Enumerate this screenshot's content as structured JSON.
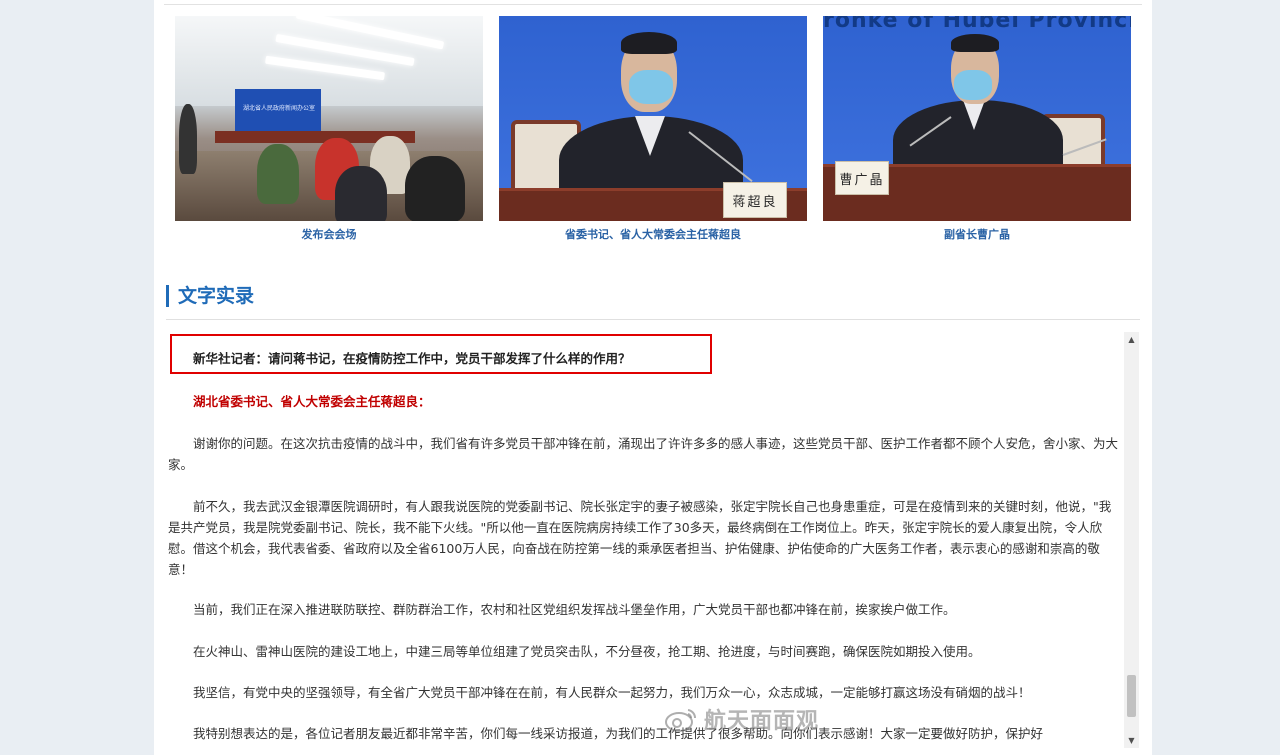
{
  "gallery": {
    "photos": [
      {
        "caption": "发布会会场",
        "screen_text": "湖北省人民政府新闻办公室"
      },
      {
        "caption": "省委书记、省人大常委会主任蒋超良",
        "nameplate": "蒋超良"
      },
      {
        "caption": "副省长曹广晶",
        "nameplate": "曹广晶",
        "wall_text": "ronke of Hubei Provincial"
      }
    ]
  },
  "section": {
    "title": "文字实录"
  },
  "transcript": {
    "question": "新华社记者：请问蒋书记，在疫情防控工作中，党员干部发挥了什么样的作用？",
    "speaker": "湖北省委书记、省人大常委会主任蒋超良：",
    "paragraphs": [
      "谢谢你的问题。在这次抗击疫情的战斗中，我们省有许多党员干部冲锋在前，涌现出了许许多多的感人事迹，这些党员干部、医护工作者都不顾个人安危，舍小家、为大家。",
      "前不久，我去武汉金银潭医院调研时，有人跟我说医院的党委副书记、院长张定宇的妻子被感染，张定宇院长自己也身患重症，可是在疫情到来的关键时刻，他说，\"我是共产党员，我是院党委副书记、院长，我不能下火线。\"所以他一直在医院病房持续工作了30多天，最终病倒在工作岗位上。昨天，张定宇院长的爱人康复出院，令人欣慰。借这个机会，我代表省委、省政府以及全省6100万人民，向奋战在防控第一线的乘承医者担当、护佑健康、护佑使命的广大医务工作者，表示衷心的感谢和崇高的敬意！",
      "当前，我们正在深入推进联防联控、群防群治工作，农村和社区党组织发挥战斗堡垒作用，广大党员干部也都冲锋在前，挨家挨户做工作。",
      "在火神山、雷神山医院的建设工地上，中建三局等单位组建了党员突击队，不分昼夜，抢工期、抢进度，与时间赛跑，确保医院如期投入使用。",
      "我坚信，有党中央的坚强领导，有全省广大党员干部冲锋在在前，有人民群众一起努力，我们万众一心，众志成城，一定能够打赢这场没有硝烟的战斗！",
      "我特别想表达的是，各位记者朋友最近都非常辛苦，你们每一线采访报道，为我们的工作提供了很多帮助。向你们表示感谢！大家一定要做好防护，保护好"
    ]
  },
  "watermark": {
    "text": "航天面面观"
  }
}
